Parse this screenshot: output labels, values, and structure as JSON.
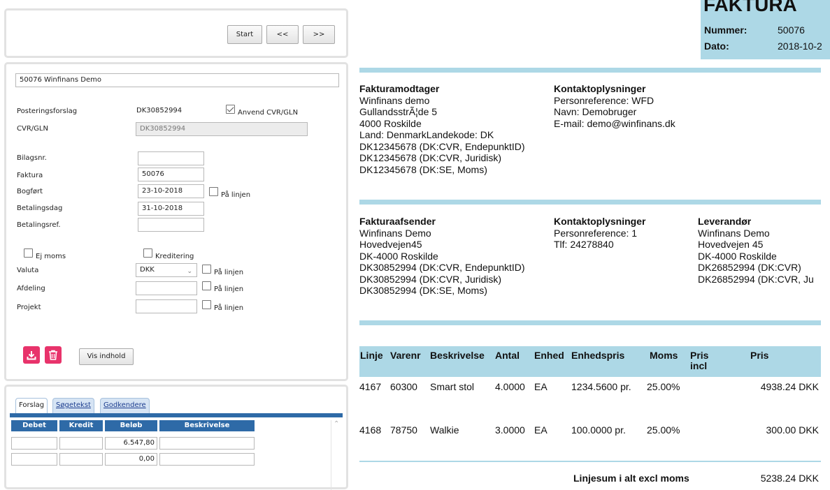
{
  "nav": {
    "start": "Start",
    "prev": "<<",
    "next": ">>"
  },
  "form": {
    "title_value": "50076 Winfinans Demo",
    "posteringsforslag_label": "Posteringsforslag",
    "posteringsforslag_value": "DK30852994",
    "anvend_label": "Anvend CVR/GLN",
    "anvend_checked": true,
    "cvr_label": "CVR/GLN",
    "cvr_value": "DK30852994",
    "bilagsnr_label": "Bilagsnr.",
    "bilagsnr_value": "",
    "faktura_label": "Faktura",
    "faktura_value": "50076",
    "bogfort_label": "Bogført",
    "bogfort_value": "23-10-2018",
    "betalingsdag_label": "Betalingsdag",
    "betalingsdag_value": "31-10-2018",
    "betalingsref_label": "Betalingsref.",
    "betalingsref_value": "",
    "paa_linjen": "På linjen",
    "ej_moms_label": "Ej moms",
    "kreditering_label": "Kreditering",
    "valuta_label": "Valuta",
    "valuta_value": "DKK",
    "afdeling_label": "Afdeling",
    "projekt_label": "Projekt",
    "vis_indhold": "Vis indhold"
  },
  "tabs": {
    "items": [
      "Forslag",
      "Søgetekst",
      "Godkendere"
    ],
    "columns": [
      "Debet",
      "Kredit",
      "Beløb",
      "Beskrivelse"
    ],
    "rows": [
      {
        "debet": "",
        "kredit": "",
        "belob": "6.547,80",
        "beskrivelse": ""
      },
      {
        "debet": "",
        "kredit": "",
        "belob": "0,00",
        "beskrivelse": ""
      }
    ]
  },
  "invoice": {
    "title": "FAKTURA",
    "nummer_label": "Nummer:",
    "nummer_value": "50076",
    "dato_label": "Dato:",
    "dato_value": "2018-10-2",
    "recipient": {
      "heading": "Fakturamodtager",
      "lines": [
        "Winfinans demo",
        "GullandsstrÃ¦de  5",
        "4000  Roskilde",
        "Land: DenmarkLandekode: DK",
        "DK12345678 (DK:CVR, EndepunktID)",
        "DK12345678 (DK:CVR, Juridisk)",
        "DK12345678 (DK:SE, Moms)"
      ]
    },
    "recipient_contact": {
      "heading": "Kontaktoplysninger",
      "lines": [
        "Personreference: WFD",
        "Navn: Demobruger",
        "E-mail: demo@winfinans.dk"
      ]
    },
    "sender": {
      "heading": "Fakturaafsender",
      "lines": [
        "Winfinans Demo",
        "Hovedvejen45",
        "DK-4000 Roskilde",
        "DK30852994 (DK:CVR, EndepunktID)",
        "DK30852994 (DK:CVR, Juridisk)",
        "DK30852994 (DK:SE, Moms)"
      ]
    },
    "sender_contact": {
      "heading": "Kontaktoplysninger",
      "lines": [
        "Personreference: 1",
        "Tlf: 24278840"
      ]
    },
    "supplier": {
      "heading": "Leverandør",
      "lines": [
        "Winfinans Demo",
        "Hovedvejen 45",
        "DK-4000 Roskilde",
        "DK26852994 (DK:CVR)",
        "DK26852994 (DK:CVR, Ju"
      ]
    },
    "table": {
      "headers": {
        "linje": "Linje",
        "varenr": "Varenr",
        "beskrivelse": "Beskrivelse",
        "antal": "Antal",
        "enhed": "Enhed",
        "enhedspris": "Enhedspris",
        "moms": "Moms",
        "pris_incl_1": "Pris",
        "pris_incl_2": "incl",
        "pris": "Pris"
      },
      "rows": [
        {
          "linje": "4167",
          "varenr": "60300",
          "beskrivelse": "Smart stol",
          "antal": "4.0000",
          "enhed": "EA",
          "enhedspris": "1234.5600 pr.",
          "moms": "25.00%",
          "pris": "4938.24 DKK"
        },
        {
          "linje": "4168",
          "varenr": "78750",
          "beskrivelse": "Walkie",
          "antal": "3.0000",
          "enhed": "EA",
          "enhedspris": "100.0000 pr.",
          "moms": "25.00%",
          "pris": "300.00 DKK"
        }
      ]
    },
    "total_label": "Linjesum i alt excl moms",
    "total_value": "5238.24 DKK"
  }
}
